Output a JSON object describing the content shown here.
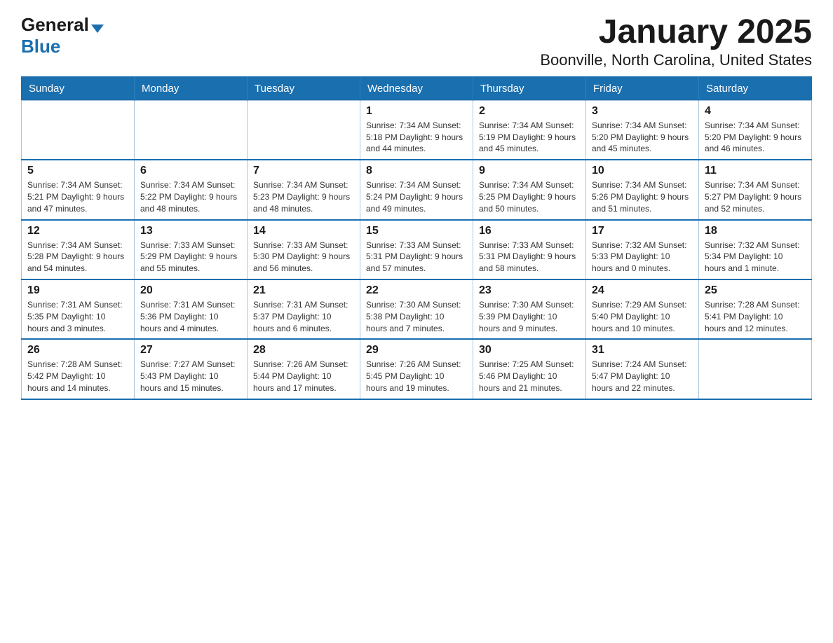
{
  "header": {
    "logo_general": "General",
    "logo_blue": "Blue",
    "title": "January 2025",
    "subtitle": "Boonville, North Carolina, United States"
  },
  "calendar": {
    "days_of_week": [
      "Sunday",
      "Monday",
      "Tuesday",
      "Wednesday",
      "Thursday",
      "Friday",
      "Saturday"
    ],
    "weeks": [
      [
        {
          "day": "",
          "info": ""
        },
        {
          "day": "",
          "info": ""
        },
        {
          "day": "",
          "info": ""
        },
        {
          "day": "1",
          "info": "Sunrise: 7:34 AM\nSunset: 5:18 PM\nDaylight: 9 hours and 44 minutes."
        },
        {
          "day": "2",
          "info": "Sunrise: 7:34 AM\nSunset: 5:19 PM\nDaylight: 9 hours and 45 minutes."
        },
        {
          "day": "3",
          "info": "Sunrise: 7:34 AM\nSunset: 5:20 PM\nDaylight: 9 hours and 45 minutes."
        },
        {
          "day": "4",
          "info": "Sunrise: 7:34 AM\nSunset: 5:20 PM\nDaylight: 9 hours and 46 minutes."
        }
      ],
      [
        {
          "day": "5",
          "info": "Sunrise: 7:34 AM\nSunset: 5:21 PM\nDaylight: 9 hours and 47 minutes."
        },
        {
          "day": "6",
          "info": "Sunrise: 7:34 AM\nSunset: 5:22 PM\nDaylight: 9 hours and 48 minutes."
        },
        {
          "day": "7",
          "info": "Sunrise: 7:34 AM\nSunset: 5:23 PM\nDaylight: 9 hours and 48 minutes."
        },
        {
          "day": "8",
          "info": "Sunrise: 7:34 AM\nSunset: 5:24 PM\nDaylight: 9 hours and 49 minutes."
        },
        {
          "day": "9",
          "info": "Sunrise: 7:34 AM\nSunset: 5:25 PM\nDaylight: 9 hours and 50 minutes."
        },
        {
          "day": "10",
          "info": "Sunrise: 7:34 AM\nSunset: 5:26 PM\nDaylight: 9 hours and 51 minutes."
        },
        {
          "day": "11",
          "info": "Sunrise: 7:34 AM\nSunset: 5:27 PM\nDaylight: 9 hours and 52 minutes."
        }
      ],
      [
        {
          "day": "12",
          "info": "Sunrise: 7:34 AM\nSunset: 5:28 PM\nDaylight: 9 hours and 54 minutes."
        },
        {
          "day": "13",
          "info": "Sunrise: 7:33 AM\nSunset: 5:29 PM\nDaylight: 9 hours and 55 minutes."
        },
        {
          "day": "14",
          "info": "Sunrise: 7:33 AM\nSunset: 5:30 PM\nDaylight: 9 hours and 56 minutes."
        },
        {
          "day": "15",
          "info": "Sunrise: 7:33 AM\nSunset: 5:31 PM\nDaylight: 9 hours and 57 minutes."
        },
        {
          "day": "16",
          "info": "Sunrise: 7:33 AM\nSunset: 5:31 PM\nDaylight: 9 hours and 58 minutes."
        },
        {
          "day": "17",
          "info": "Sunrise: 7:32 AM\nSunset: 5:33 PM\nDaylight: 10 hours and 0 minutes."
        },
        {
          "day": "18",
          "info": "Sunrise: 7:32 AM\nSunset: 5:34 PM\nDaylight: 10 hours and 1 minute."
        }
      ],
      [
        {
          "day": "19",
          "info": "Sunrise: 7:31 AM\nSunset: 5:35 PM\nDaylight: 10 hours and 3 minutes."
        },
        {
          "day": "20",
          "info": "Sunrise: 7:31 AM\nSunset: 5:36 PM\nDaylight: 10 hours and 4 minutes."
        },
        {
          "day": "21",
          "info": "Sunrise: 7:31 AM\nSunset: 5:37 PM\nDaylight: 10 hours and 6 minutes."
        },
        {
          "day": "22",
          "info": "Sunrise: 7:30 AM\nSunset: 5:38 PM\nDaylight: 10 hours and 7 minutes."
        },
        {
          "day": "23",
          "info": "Sunrise: 7:30 AM\nSunset: 5:39 PM\nDaylight: 10 hours and 9 minutes."
        },
        {
          "day": "24",
          "info": "Sunrise: 7:29 AM\nSunset: 5:40 PM\nDaylight: 10 hours and 10 minutes."
        },
        {
          "day": "25",
          "info": "Sunrise: 7:28 AM\nSunset: 5:41 PM\nDaylight: 10 hours and 12 minutes."
        }
      ],
      [
        {
          "day": "26",
          "info": "Sunrise: 7:28 AM\nSunset: 5:42 PM\nDaylight: 10 hours and 14 minutes."
        },
        {
          "day": "27",
          "info": "Sunrise: 7:27 AM\nSunset: 5:43 PM\nDaylight: 10 hours and 15 minutes."
        },
        {
          "day": "28",
          "info": "Sunrise: 7:26 AM\nSunset: 5:44 PM\nDaylight: 10 hours and 17 minutes."
        },
        {
          "day": "29",
          "info": "Sunrise: 7:26 AM\nSunset: 5:45 PM\nDaylight: 10 hours and 19 minutes."
        },
        {
          "day": "30",
          "info": "Sunrise: 7:25 AM\nSunset: 5:46 PM\nDaylight: 10 hours and 21 minutes."
        },
        {
          "day": "31",
          "info": "Sunrise: 7:24 AM\nSunset: 5:47 PM\nDaylight: 10 hours and 22 minutes."
        },
        {
          "day": "",
          "info": ""
        }
      ]
    ]
  }
}
